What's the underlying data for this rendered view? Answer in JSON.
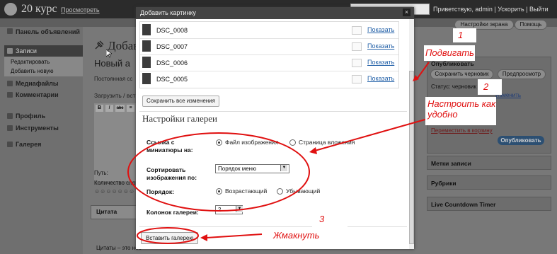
{
  "admin_bar": {
    "site_title": "20 курс",
    "site_link": "Просмотреть",
    "user_links": "Приветствую, admin | Ускорить | Выйти"
  },
  "sidebar": {
    "items": [
      {
        "label": "Панель объявлений"
      },
      {
        "label": "Записи"
      },
      {
        "label": "Медиафайлы"
      },
      {
        "label": "Комментарии"
      },
      {
        "label": "Профиль"
      },
      {
        "label": "Инструменты"
      },
      {
        "label": "Галерея"
      }
    ],
    "sub_items": [
      {
        "label": "Редактировать"
      },
      {
        "label": "Добавить новую"
      }
    ]
  },
  "editor_bg": {
    "page_title": "Добавить",
    "post_title": "Новый а",
    "permalink": "Постоянная сс",
    "upload": "Загрузить / вст",
    "path": "Путь:",
    "word_count": "Количество сло",
    "excerpt_label": "Цитата",
    "excerpt_text": "Цитаты – это нео"
  },
  "right_col": {
    "screen_options": "Настройки экрана",
    "help": "Помощь",
    "publish_head": "Опубликовать",
    "save_draft": "Сохранить черновик",
    "preview": "Предпросмотр",
    "status": "Статус: черновик",
    "status_edit": "Изменить",
    "trash": "Переместить в корзину",
    "publish_btn": "Опубликовать",
    "tags_head": "Метки записи",
    "categories_head": "Рубрики",
    "countdown_head": "Live Countdown Timer"
  },
  "dialog": {
    "title": "Добавить картинку",
    "close": "×",
    "images": [
      {
        "name": "DSC_0008",
        "link": "Показать"
      },
      {
        "name": "DSC_0007",
        "link": "Показать"
      },
      {
        "name": "DSC_0006",
        "link": "Показать"
      },
      {
        "name": "DSC_0005",
        "link": "Показать"
      }
    ],
    "save_all": "Сохранить все изменения",
    "gallery_heading": "Настройки галереи",
    "link_label": "Ссылка с миниатюры на:",
    "link_opt1": "Файл изображения",
    "link_opt2": "Страница вложения",
    "sort_label": "Сортировать изображения по:",
    "sort_value": "Порядок меню",
    "order_label": "Порядок:",
    "order_opt1": "Возрастающий",
    "order_opt2": "Убывающий",
    "columns_label": "Колонок галереи:",
    "columns_value": "2",
    "insert_btn": "Вставить галерею"
  },
  "annotations": {
    "n1": "1",
    "n2": "2",
    "n3": "3",
    "move": "Подвигать",
    "configure": "Настроить как удобно",
    "click": "Жмакнуть"
  }
}
